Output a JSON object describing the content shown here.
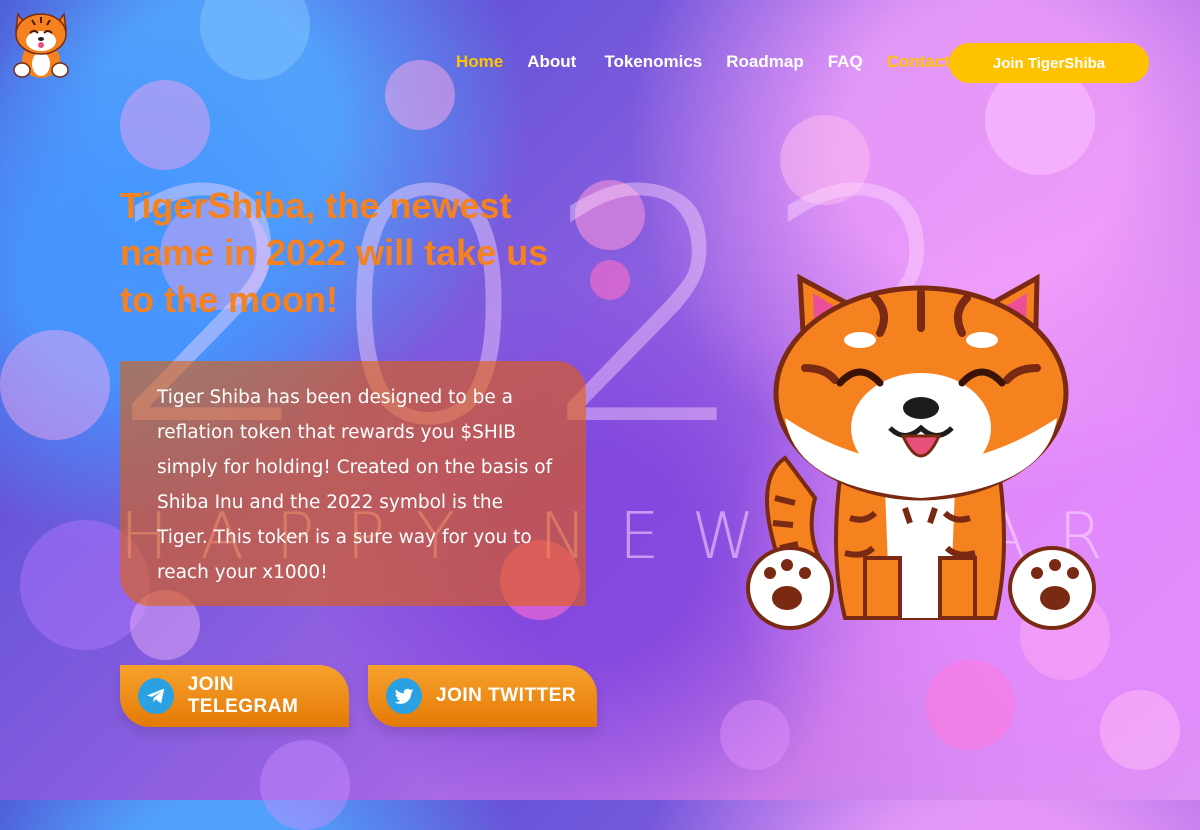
{
  "background_text": {
    "year": "2022",
    "greeting": "HAPPY NEW YEAR"
  },
  "nav": {
    "items": [
      {
        "label": "Home",
        "active": true
      },
      {
        "label": "About"
      },
      {
        "label": "Tokenomics"
      },
      {
        "label": "Roadmap"
      },
      {
        "label": "FAQ"
      },
      {
        "label": "Contact",
        "highlight": true
      }
    ],
    "cta_label": "Join TigerShiba"
  },
  "hero": {
    "title": "TigerShiba, the newest name in 2022 will take us to the moon!",
    "description": "Tiger Shiba has been designed to be a reflation token that rewards you $SHIB simply for holding! Created on the basis of Shiba Inu and the 2022 symbol is the Tiger. This token is a sure way for you to reach your x1000!"
  },
  "social": {
    "telegram_label": "JOIN TELEGRAM",
    "twitter_label": "JOIN TWITTER"
  },
  "icons": {
    "logo": "tiger-shiba-logo-icon",
    "telegram": "telegram-icon",
    "twitter": "twitter-icon",
    "mascot": "tiger-shiba-mascot"
  },
  "colors": {
    "accent_yellow": "#ffc200",
    "accent_orange": "#f5821f",
    "social_blue": "#2aa1e3"
  }
}
